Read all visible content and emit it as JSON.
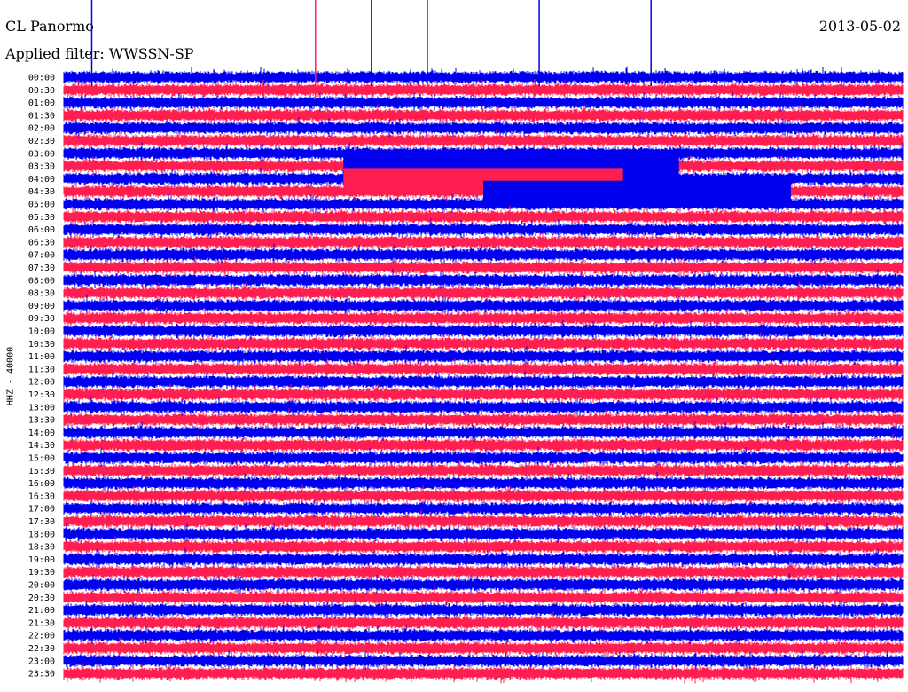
{
  "header": {
    "station": "CL Panormo",
    "date": "2013-05-02",
    "filter": "Applied filter: WWSSN-SP",
    "channel_label": "HHZ - 40000"
  },
  "colors": {
    "trace_a": "#0000ee",
    "trace_b": "#ff1e50",
    "background": "#ffffff"
  },
  "chart_data": {
    "type": "line",
    "ylabel": "HHZ - 40000",
    "row_labels": [
      "00:00",
      "00:30",
      "01:00",
      "01:30",
      "02:00",
      "02:30",
      "03:00",
      "03:30",
      "04:00",
      "04:30",
      "05:00",
      "05:30",
      "06:00",
      "06:30",
      "07:00",
      "07:30",
      "08:00",
      "08:30",
      "09:00",
      "09:30",
      "10:00",
      "10:30",
      "11:00",
      "11:30",
      "12:00",
      "12:30",
      "13:00",
      "13:30",
      "14:00",
      "14:30",
      "15:00",
      "15:30",
      "16:00",
      "16:30",
      "17:00",
      "17:30",
      "18:00",
      "18:30",
      "19:00",
      "19:30",
      "20:00",
      "20:30",
      "21:00",
      "21:30",
      "22:00",
      "22:30",
      "23:00",
      "23:30"
    ],
    "row_colors": [
      "trace_a",
      "trace_b"
    ],
    "row_duration_minutes": 30,
    "grid": false,
    "spikes": [
      {
        "row": 0,
        "minute": 1,
        "color": "trace_a"
      },
      {
        "row": 0,
        "minute": 21,
        "color": "trace_a"
      },
      {
        "row": 0,
        "minute": 41,
        "color": "trace_a"
      },
      {
        "row": 0,
        "minute": 47,
        "color": "trace_a"
      },
      {
        "row": 0,
        "minute": 313,
        "color": "trace_a"
      },
      {
        "row": 1,
        "minute": 369,
        "color": "trace_b"
      }
    ],
    "dense_segments": [
      {
        "row": 7,
        "start_minute": 190,
        "end_minute": 202,
        "color": "trace_a"
      },
      {
        "row": 8,
        "start_minute": 320,
        "end_minute": 340,
        "color": "trace_b"
      },
      {
        "row": 9,
        "start_minute": 225,
        "end_minute": 236,
        "color": "trace_a"
      }
    ]
  }
}
